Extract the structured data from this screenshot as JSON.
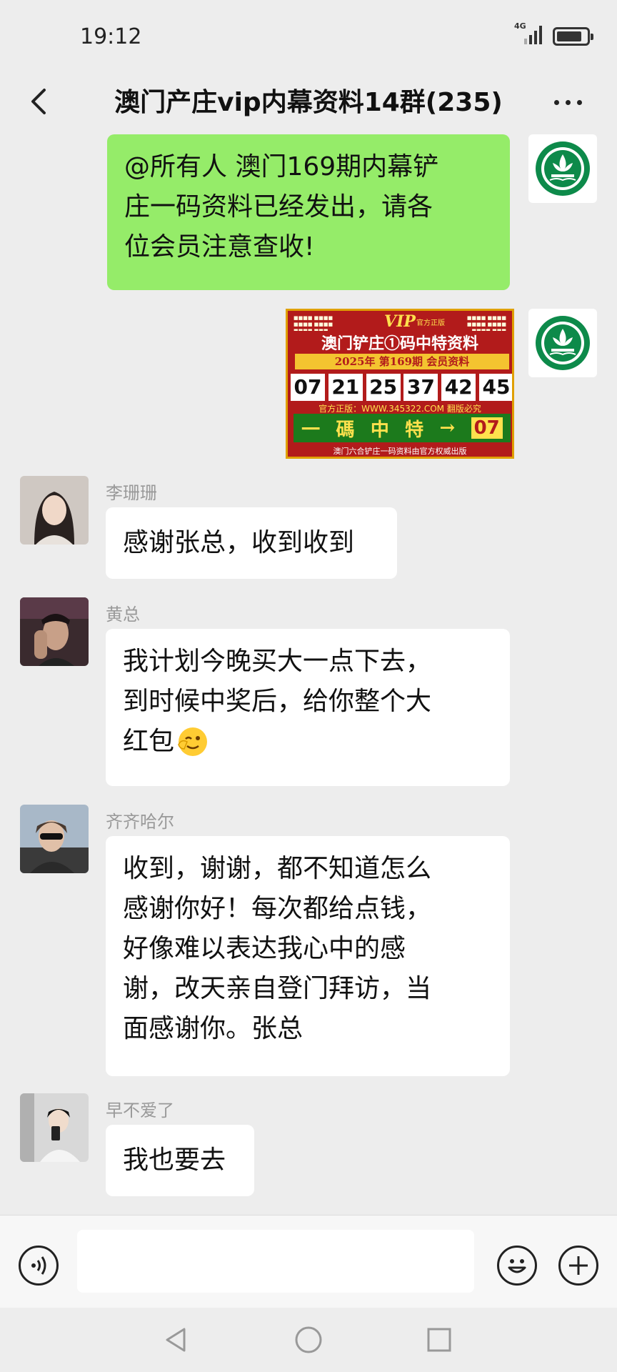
{
  "status_bar": {
    "time": "19:12",
    "network": "4G",
    "battery_level": 0.85
  },
  "header": {
    "title": "澳门产庄vip内幕资料14群(235)"
  },
  "messages": [
    {
      "type": "text",
      "side": "right",
      "avatar": "macau-emblem",
      "lines": [
        "@所有人 澳门169期内幕铲",
        "庄一码资料已经发出，请各",
        "位会员注意查收!"
      ]
    },
    {
      "type": "image",
      "side": "right",
      "avatar": "macau-emblem",
      "poster": {
        "vip": "VIP",
        "headline": "澳门铲庄①码中特资料",
        "year_bar": "2025年 第169期 会员资料",
        "numbers": [
          "07",
          "21",
          "25",
          "37",
          "42",
          "45"
        ],
        "site": "官方正版：WWW.345322.COM 翻版必究",
        "special_chars": [
          "一",
          "碼",
          "中",
          "特",
          "→"
        ],
        "special_number": "07",
        "footer": "澳门六合铲庄一码资料由官方权威出版",
        "official_label": "官方正版"
      }
    },
    {
      "type": "text",
      "side": "left",
      "sender": "李珊珊",
      "lines": [
        "感谢张总，收到收到"
      ]
    },
    {
      "type": "text",
      "side": "left",
      "sender": "黄总",
      "lines": [
        "我计划今晚买大一点下去，",
        "到时候中奖后，给你整个大",
        "红包"
      ],
      "emoji": "wink-face"
    },
    {
      "type": "text",
      "side": "left",
      "sender": "齐齐哈尔",
      "lines": [
        "收到，谢谢，都不知道怎么",
        "感谢你好！每次都给点钱，",
        "好像难以表达我心中的感",
        "谢，改天亲自登门拜访，当",
        "面感谢你。张总"
      ]
    },
    {
      "type": "text",
      "side": "left",
      "sender": "早不爱了",
      "lines": [
        "我也要去"
      ]
    }
  ],
  "input_bar": {
    "placeholder": ""
  },
  "colors": {
    "background": "#ededed",
    "bubble_self": "#95ec69",
    "bubble_other": "#ffffff",
    "sender_name": "#999999"
  }
}
